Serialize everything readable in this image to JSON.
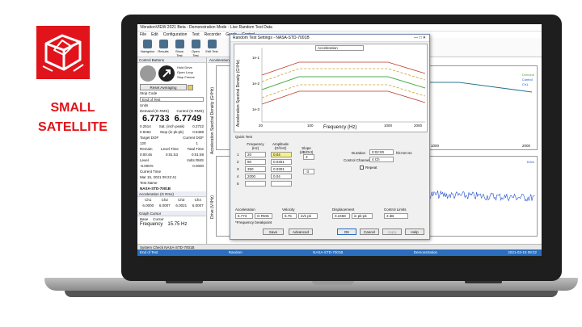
{
  "brand": {
    "line1": "SMALL",
    "line2": "SATELLITE"
  },
  "app": {
    "title": "VibrationVIEW 2021 Beta - Demonstration Mode - Live Random Test Data"
  },
  "menu": [
    "File",
    "Edit",
    "Configuration",
    "Test",
    "Recorder",
    "Graph",
    "Control"
  ],
  "toolbar": [
    "Navigator",
    "Results",
    "Show Test",
    "Open Test",
    "Edit Test"
  ],
  "panel": {
    "header": "Control Buttons",
    "side_labels": [
      "Hold Drive",
      "Open Loop",
      "Stop Freeze"
    ],
    "reset_button": "Reset Averaging",
    "stop_code_label": "Stop Code",
    "stop_code_value": "End of Test",
    "units": "Units",
    "demand_label": "Demand (G RMS)",
    "control_label": "Control (G RMS)",
    "demand_value": "6.7733",
    "control_value": "6.7749",
    "row_values": [
      "0.2514",
      "Sat. (inch peak)",
      "0.2722"
    ],
    "row_values2": [
      "0.9462",
      "Stop (in pk-pk)",
      "0.5468"
    ],
    "target_label": "Target DOF",
    "current_label": "Current DOF",
    "target_value": "120",
    "current_value": "1",
    "remain_label": "Remain",
    "level_label": "Level Time",
    "total_label": "Total Time",
    "remain_value": "0:00:46",
    "level_value": "0:01:53",
    "total_value": "0:01:59",
    "level_pct_label": "Level",
    "level_pct": "-6.000%",
    "volts_label": "Volts RMS",
    "volts_value": "0.0000",
    "current_time_label": "Current Time",
    "current_time_value": "Mar 15, 2021 09:22:41",
    "test_name_label": "Test Name",
    "test_name_value": "NASA-STD-7001B",
    "accel_header": "Acceleration (G Rms)",
    "ch_labels": [
      "Ch1",
      "Ch2",
      "Ch3",
      "Ch4"
    ],
    "ch_values": [
      "6.0000",
      "6.0007",
      "6.0021",
      "6.0007"
    ],
    "graph_cursor": "Graph Cursor",
    "base": "Base",
    "cursor": "Cursor",
    "freq_label": "Frequency",
    "freq_value": "15.75 Hz"
  },
  "main": {
    "tab": "Acceleration Spectral",
    "y_label_top": "Acceleration Spectral Density (G²/Hz)",
    "y_label_bottom": "Drive (V²/Hz)",
    "y_ticks_top": [
      "1e-1",
      "1e-2",
      "1e-3",
      "1e-4",
      "1e-5"
    ],
    "y_ticks_bottom": [
      "1e-3",
      "1e-4",
      "1e-5",
      "1e-6"
    ],
    "x_ticks": [
      "20",
      "100",
      "1000",
      "2000"
    ],
    "legend": [
      "Demand",
      "Control",
      "Ch1"
    ],
    "drive_label": "Drive"
  },
  "dialog": {
    "title": "Random Test Settings - NASA-STD-7001B",
    "dropdown": "Acceleration",
    "y_label": "Acceleration Spectral Density (G²/Hz)",
    "y_ticks": [
      "1e-1",
      "1e-2",
      "1e-3"
    ],
    "x_label": "Frequency (Hz)",
    "x_ticks": [
      "20",
      "100",
      "1000",
      "2000"
    ],
    "tab": "Quick Test",
    "col_freq": "Frequency (Hz)",
    "col_amp": "Amplitude (G²/Hz)",
    "col_slope": "Slope (dB/Oct)",
    "rows": [
      {
        "n": "1",
        "freq": "20",
        "amp": "0.04"
      },
      {
        "n": "2",
        "freq": "80",
        "amp": "0.0301"
      },
      {
        "n": "3",
        "freq": "350",
        "amp": "0.0301"
      },
      {
        "n": "4",
        "freq": "2000",
        "amp": "0.04"
      },
      {
        "n": "5",
        "freq": "",
        "amp": ""
      }
    ],
    "slope_values": [
      "3",
      "-3"
    ],
    "duration_label": "Duration",
    "duration_value": "0:02:00",
    "duration_unit": "hh:mm:ss",
    "control_channel_label": "Control Channel",
    "control_channel_value": "4 Ch",
    "repeat_label": "Repeat",
    "accel_label": "Acceleration",
    "accel_value": "6.773",
    "accel_unit": "G RMS",
    "velocity_label": "Velocity",
    "velocity_value": "6.75",
    "velocity_unit": "in/s pk",
    "disp_label": "Displacement",
    "disp_value": "0.2458",
    "disp_unit": "in pk-pk",
    "control_limits_label": "Control Limits",
    "control_limits_value": "3 dB",
    "note": "*Frequency breakpoint",
    "buttons": {
      "save": "Save",
      "advanced": "Advanced",
      "ok": "OK",
      "cancel": "Cancel",
      "apply": "Apply",
      "help": "Help"
    }
  },
  "system_check": "System Check  NASA-STD-7001B",
  "status": {
    "left": "End of Test",
    "mid": "Random",
    "test": "NASA-STD-7001B",
    "mode": "Demonstration",
    "date": "2021-03-15 09:22"
  },
  "colors": {
    "brand": "#e0141a",
    "status": "#2a6ebd",
    "demand": "#4caf50",
    "abort": "#c0392b",
    "warn": "#c9a227",
    "control": "#1f4fd1"
  }
}
